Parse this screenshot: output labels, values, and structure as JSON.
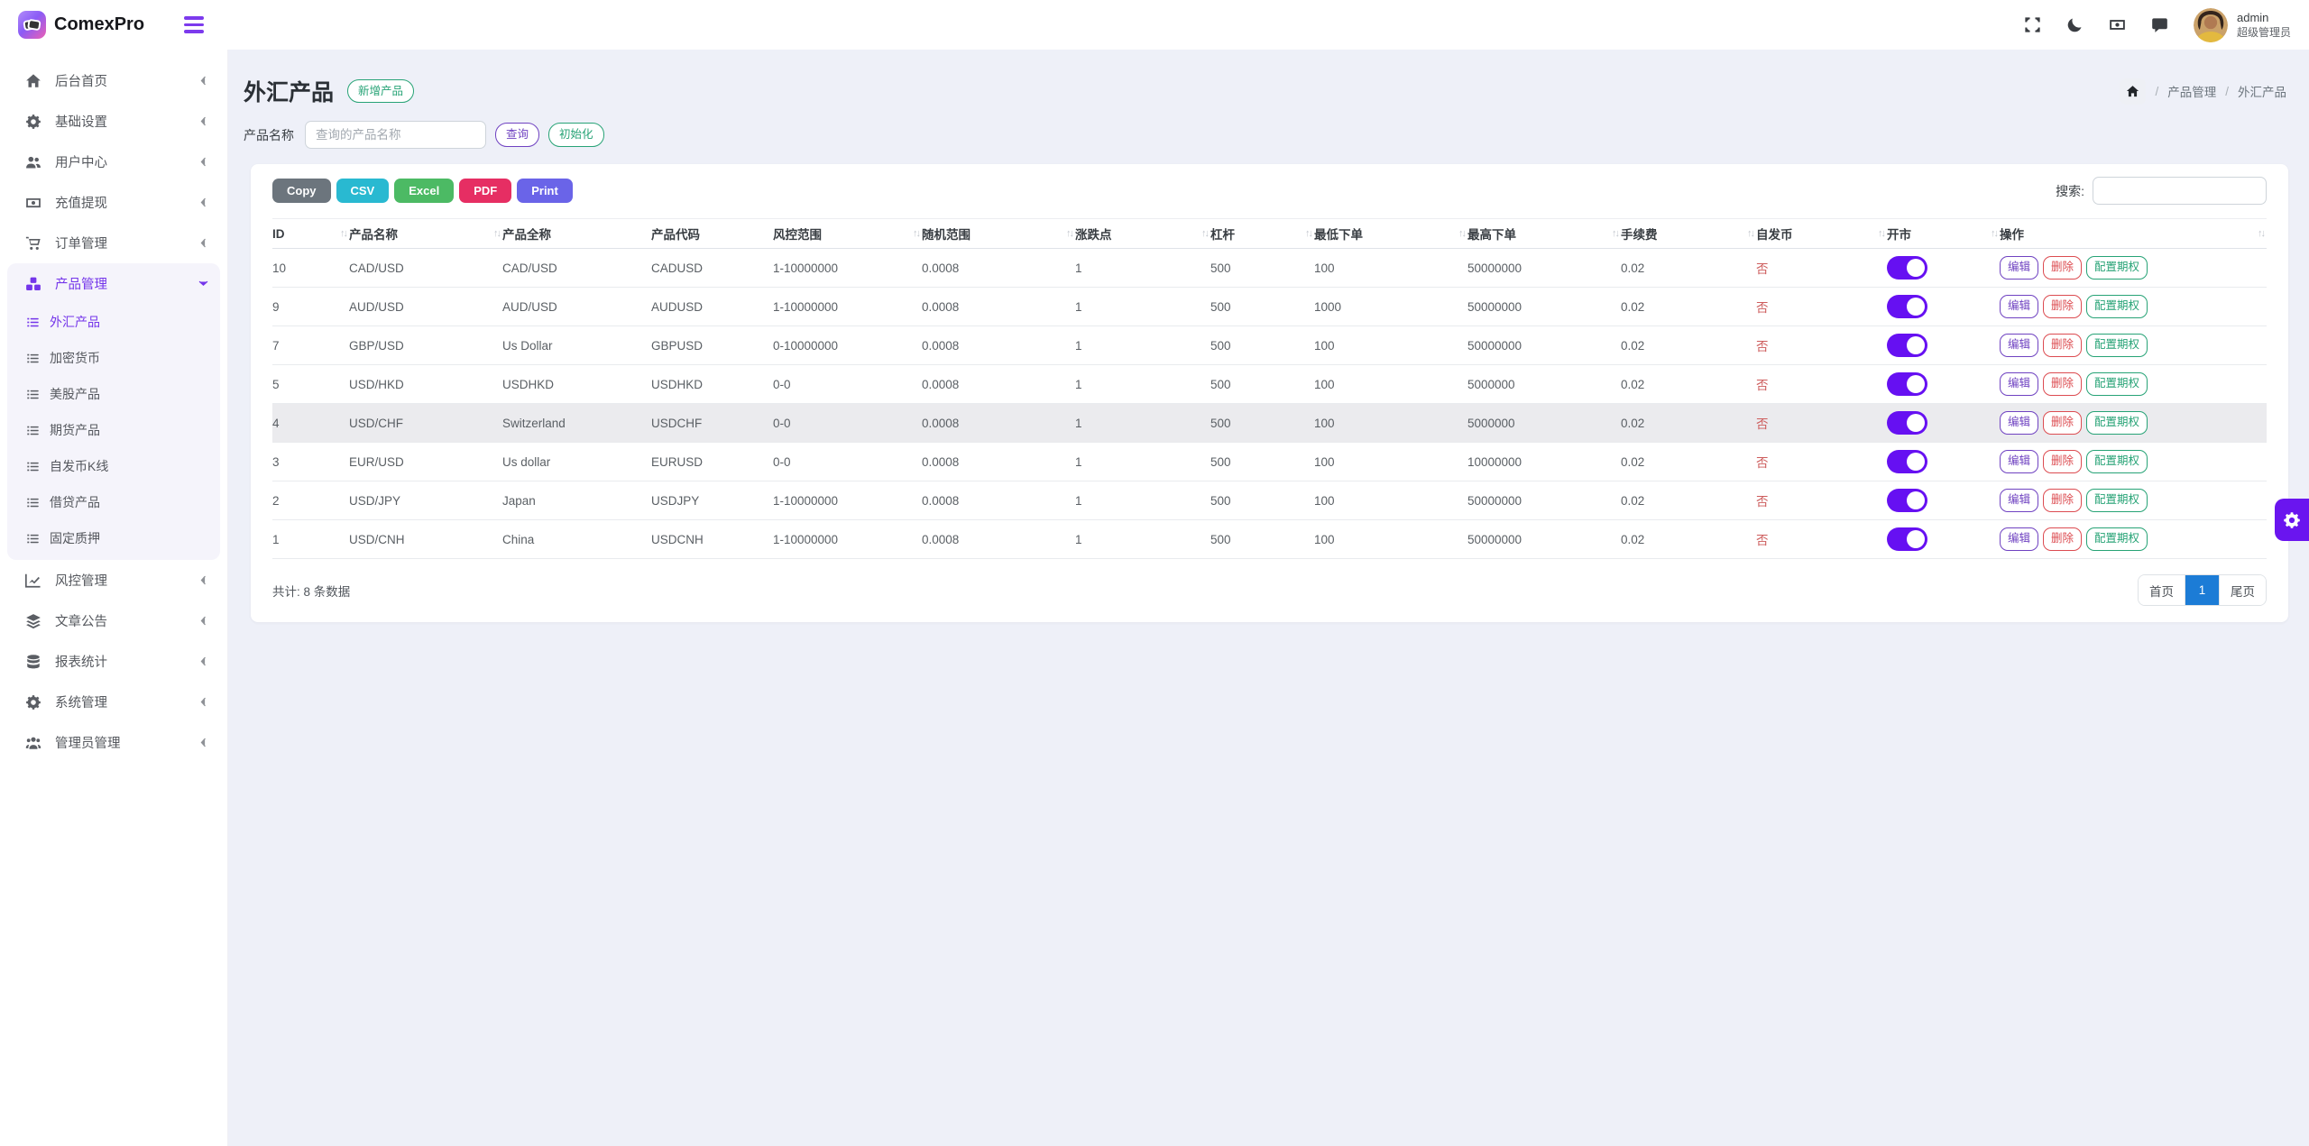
{
  "brand": {
    "name": "ComexPro"
  },
  "topbar": {
    "icons": [
      "fullscreen",
      "moon",
      "money",
      "chat"
    ],
    "admin_name": "admin",
    "admin_role": "超级管理员"
  },
  "sidebar": {
    "items": [
      {
        "label": "后台首页",
        "icon": "home"
      },
      {
        "label": "基础设置",
        "icon": "settings"
      },
      {
        "label": "用户中心",
        "icon": "users"
      },
      {
        "label": "充值提现",
        "icon": "money"
      },
      {
        "label": "订单管理",
        "icon": "cart"
      },
      {
        "label": "产品管理",
        "icon": "cubes",
        "active": true,
        "expanded": true,
        "children": [
          {
            "label": "外汇产品",
            "active": true
          },
          {
            "label": "加密货币"
          },
          {
            "label": "美股产品"
          },
          {
            "label": "期货产品"
          },
          {
            "label": "自发币K线"
          },
          {
            "label": "借贷产品"
          },
          {
            "label": "固定质押"
          }
        ]
      },
      {
        "label": "风控管理",
        "icon": "chart"
      },
      {
        "label": "文章公告",
        "icon": "layers"
      },
      {
        "label": "报表统计",
        "icon": "db"
      },
      {
        "label": "系统管理",
        "icon": "gear"
      },
      {
        "label": "管理员管理",
        "icon": "admins"
      }
    ]
  },
  "page": {
    "title": "外汇产品",
    "add_button": "新增产品",
    "breadcrumb": [
      "产品管理",
      "外汇产品"
    ]
  },
  "filter": {
    "label": "产品名称",
    "placeholder": "查询的产品名称",
    "query_button": "查询",
    "reset_button": "初始化"
  },
  "toolbar": {
    "export_buttons": [
      {
        "label": "Copy",
        "color": "#6c757d"
      },
      {
        "label": "CSV",
        "color": "#29b9d1"
      },
      {
        "label": "Excel",
        "color": "#4cba64"
      },
      {
        "label": "PDF",
        "color": "#e62e63"
      },
      {
        "label": "Print",
        "color": "#6a64e8"
      }
    ],
    "search_label": "搜索:"
  },
  "table": {
    "columns": [
      {
        "label": "ID",
        "sortable": true
      },
      {
        "label": "产品名称",
        "sortable": true
      },
      {
        "label": "产品全称",
        "sortable": false
      },
      {
        "label": "产品代码",
        "sortable": false
      },
      {
        "label": "风控范围",
        "sortable": true
      },
      {
        "label": "随机范围",
        "sortable": true
      },
      {
        "label": "涨跌点",
        "sortable": true
      },
      {
        "label": "杠杆",
        "sortable": true
      },
      {
        "label": "最低下单",
        "sortable": true
      },
      {
        "label": "最高下单",
        "sortable": true
      },
      {
        "label": "手续费",
        "sortable": true
      },
      {
        "label": "自发币",
        "sortable": true
      },
      {
        "label": "开市",
        "sortable": true
      },
      {
        "label": "操作",
        "sortable": true
      }
    ],
    "action_labels": {
      "edit": "编辑",
      "delete": "删除",
      "config": "配置期权"
    },
    "rows": [
      {
        "id": "10",
        "name": "CAD/USD",
        "full_name": "CAD/USD",
        "code": "CADUSD",
        "risk_range": "1-10000000",
        "random_range": "0.0008",
        "point": "1",
        "leverage": "500",
        "min_order": "100",
        "max_order": "50000000",
        "fee": "0.02",
        "self_coin": "否",
        "open": true,
        "highlight": false
      },
      {
        "id": "9",
        "name": "AUD/USD",
        "full_name": "AUD/USD",
        "code": "AUDUSD",
        "risk_range": "1-10000000",
        "random_range": "0.0008",
        "point": "1",
        "leverage": "500",
        "min_order": "1000",
        "max_order": "50000000",
        "fee": "0.02",
        "self_coin": "否",
        "open": true,
        "highlight": false
      },
      {
        "id": "7",
        "name": "GBP/USD",
        "full_name": "Us Dollar",
        "code": "GBPUSD",
        "risk_range": "0-10000000",
        "random_range": "0.0008",
        "point": "1",
        "leverage": "500",
        "min_order": "100",
        "max_order": "50000000",
        "fee": "0.02",
        "self_coin": "否",
        "open": true,
        "highlight": false
      },
      {
        "id": "5",
        "name": "USD/HKD",
        "full_name": "USDHKD",
        "code": "USDHKD",
        "risk_range": "0-0",
        "random_range": "0.0008",
        "point": "1",
        "leverage": "500",
        "min_order": "100",
        "max_order": "5000000",
        "fee": "0.02",
        "self_coin": "否",
        "open": true,
        "highlight": false
      },
      {
        "id": "4",
        "name": "USD/CHF",
        "full_name": "Switzerland",
        "code": "USDCHF",
        "risk_range": "0-0",
        "random_range": "0.0008",
        "point": "1",
        "leverage": "500",
        "min_order": "100",
        "max_order": "5000000",
        "fee": "0.02",
        "self_coin": "否",
        "open": true,
        "highlight": true
      },
      {
        "id": "3",
        "name": "EUR/USD",
        "full_name": "Us dollar",
        "code": "EURUSD",
        "risk_range": "0-0",
        "random_range": "0.0008",
        "point": "1",
        "leverage": "500",
        "min_order": "100",
        "max_order": "10000000",
        "fee": "0.02",
        "self_coin": "否",
        "open": true,
        "highlight": false
      },
      {
        "id": "2",
        "name": "USD/JPY",
        "full_name": "Japan",
        "code": "USDJPY",
        "risk_range": "1-10000000",
        "random_range": "0.0008",
        "point": "1",
        "leverage": "500",
        "min_order": "100",
        "max_order": "50000000",
        "fee": "0.02",
        "self_coin": "否",
        "open": true,
        "highlight": false
      },
      {
        "id": "1",
        "name": "USD/CNH",
        "full_name": "China",
        "code": "USDCNH",
        "risk_range": "1-10000000",
        "random_range": "0.0008",
        "point": "1",
        "leverage": "500",
        "min_order": "100",
        "max_order": "50000000",
        "fee": "0.02",
        "self_coin": "否",
        "open": true,
        "highlight": false
      }
    ]
  },
  "footer": {
    "total_text": "共计: 8 条数据",
    "pagination": {
      "first": "首页",
      "current": "1",
      "last": "尾页"
    }
  },
  "colors": {
    "accent_purple": "#6a15ef",
    "toggle_on": "#6610f2",
    "pagination_active": "#1c7cd6",
    "edit": "#6f42c1",
    "delete": "#dc4c51",
    "config": "#27a376",
    "self_coin_no": "#cd5c5c"
  }
}
